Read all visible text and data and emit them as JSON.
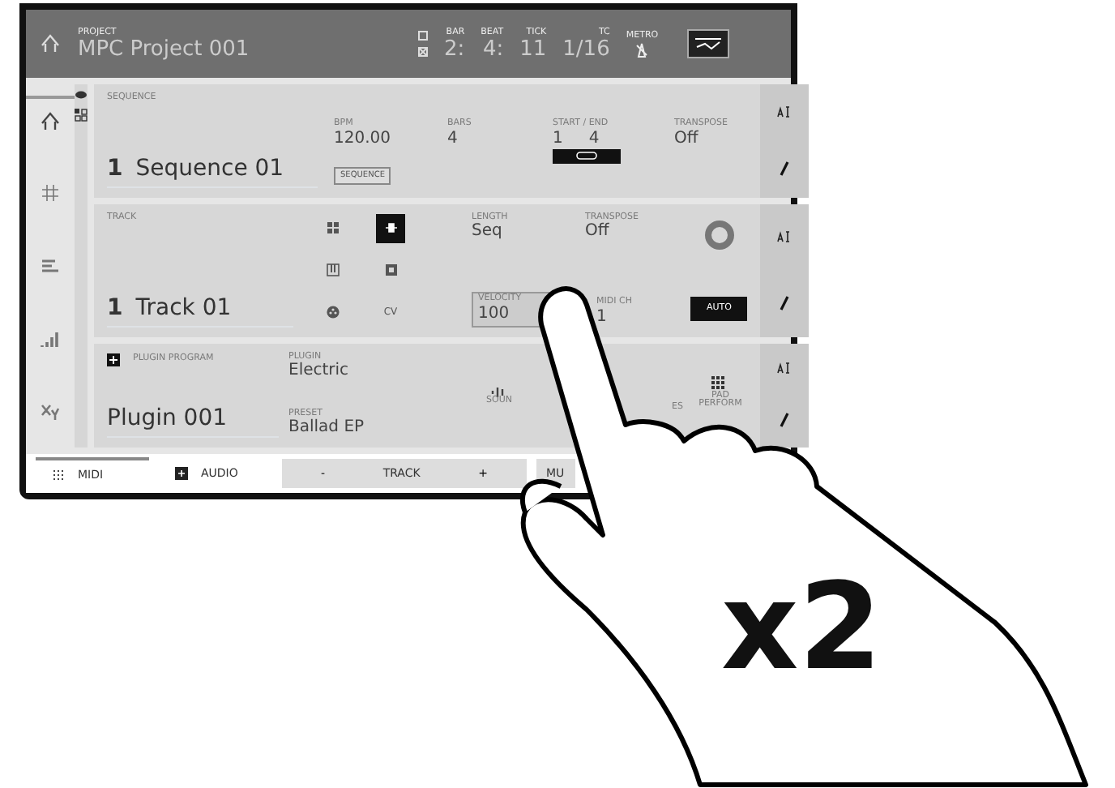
{
  "header": {
    "project_label": "PROJECT",
    "project_name": "MPC Project 001",
    "counters": [
      {
        "label": "BAR",
        "value": "2:"
      },
      {
        "label": "BEAT",
        "value": "4:"
      },
      {
        "label": "TICK",
        "value": "11"
      },
      {
        "label": "TC",
        "value": "1/16"
      }
    ],
    "metro_label": "METRO"
  },
  "sidebar": {
    "items": [
      {
        "kind": "home",
        "selected": true
      },
      {
        "kind": "grid",
        "selected": false
      },
      {
        "kind": "bars",
        "selected": false
      },
      {
        "kind": "levels",
        "selected": false
      },
      {
        "kind": "xy",
        "selected": false
      }
    ]
  },
  "sequence": {
    "label": "SEQUENCE",
    "number": "1",
    "name": "Sequence 01",
    "bpm_label": "BPM",
    "bpm": "120.00",
    "bpm_button": "SEQUENCE",
    "bars_label": "BARS",
    "bars": "4",
    "start_end_label": "START / END",
    "start": "1",
    "end": "4",
    "transpose_label": "TRANSPOSE",
    "transpose": "Off"
  },
  "track": {
    "label": "TRACK",
    "number": "1",
    "name": "Track 01",
    "types": [
      {
        "kind": "drum",
        "selected": false
      },
      {
        "kind": "plugin",
        "selected": true
      },
      {
        "kind": "keys",
        "selected": false
      },
      {
        "kind": "clip",
        "selected": false
      },
      {
        "kind": "midi",
        "selected": false
      },
      {
        "kind": "cv",
        "label": "CV",
        "selected": false
      }
    ],
    "length_label": "LENGTH",
    "length": "Seq",
    "transpose_label": "TRANSPOSE",
    "transpose": "Off",
    "velocity_label": "VELOCITY",
    "velocity": "100",
    "midi_ch_label": "MIDI CH",
    "midi_ch": "1",
    "auto_button": "AUTO"
  },
  "program": {
    "label": "PLUGIN PROGRAM",
    "name": "Plugin 001",
    "plugin_label": "PLUGIN",
    "plugin": "Electric",
    "preset_label": "PRESET",
    "preset": "Ballad EP",
    "sound_label": "SOUN",
    "effects_label": "ES",
    "pad_label": "PAD PERFORM"
  },
  "bottom_tabs": [
    {
      "label": "MIDI",
      "selected": true
    },
    {
      "label": "AUDIO",
      "selected": false
    }
  ],
  "track_control": {
    "minus": "-",
    "label": "TRACK",
    "plus": "+"
  },
  "bottom_button": "MU",
  "gesture": {
    "label": "x2"
  }
}
